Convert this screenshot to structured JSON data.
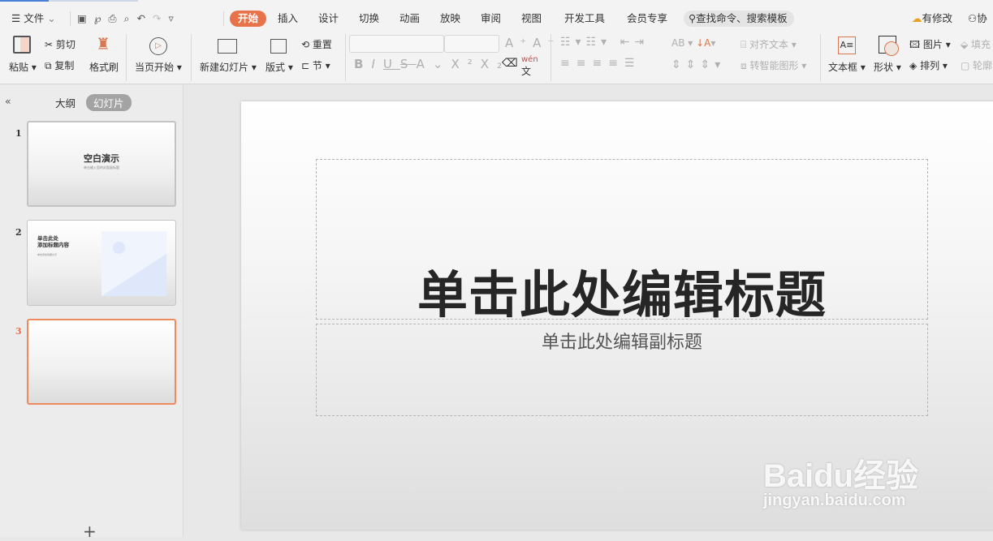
{
  "menu": {
    "file": "文件",
    "tabs": [
      "开始",
      "插入",
      "设计",
      "切换",
      "动画",
      "放映",
      "审阅",
      "视图",
      "开发工具",
      "会员专享"
    ],
    "active_tab": "开始",
    "search_placeholder": "查找命令、搜索模板",
    "modified": "有修改",
    "collab": "协"
  },
  "ribbon": {
    "paste": "粘贴",
    "cut": "剪切",
    "copy": "复制",
    "format_painter": "格式刷",
    "from_current": "当页开始",
    "new_slide": "新建幻灯片",
    "layout": "版式",
    "reset": "重置",
    "section": "节",
    "align_text": "对齐文本",
    "smartart": "转智能图形",
    "textbox": "文本框",
    "shape": "形状",
    "picture": "图片",
    "arrange": "排列",
    "fill": "填充",
    "outline": "轮廓",
    "phonetic": "wén"
  },
  "pane": {
    "outline_tab": "大纲",
    "slides_tab": "幻灯片",
    "active": "幻灯片",
    "add": "+"
  },
  "thumbnails": [
    {
      "num": "1",
      "title": "空白演示",
      "sub": "单击输入您的封面副标题"
    },
    {
      "num": "2",
      "title": "单击此处\n添加标题内容",
      "sub": "单击添加简要文字"
    },
    {
      "num": "3",
      "selected": true
    }
  ],
  "slide": {
    "title": "单击此处编辑标题",
    "subtitle": "单击此处编辑副标题"
  },
  "watermark": {
    "brand": "Baidu经验",
    "url": "jingyan.baidu.com"
  },
  "colors": {
    "accent": "#e8734a",
    "selected_border": "#f08a5d"
  }
}
